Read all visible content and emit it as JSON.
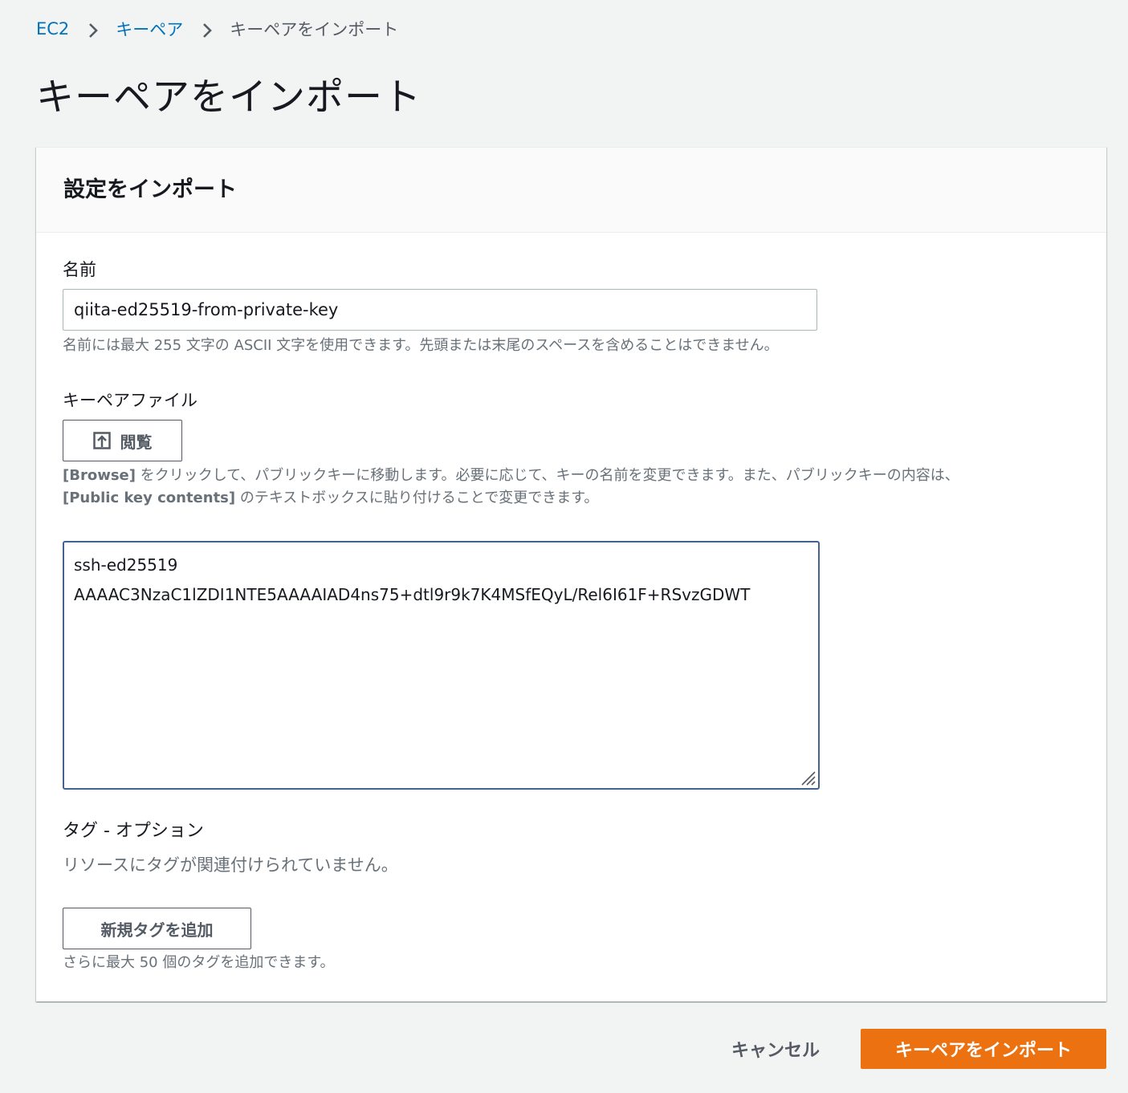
{
  "breadcrumb": {
    "items": [
      {
        "label": "EC2"
      },
      {
        "label": "キーペア"
      },
      {
        "label": "キーペアをインポート"
      }
    ]
  },
  "page": {
    "title": "キーペアをインポート"
  },
  "panel": {
    "title": "設定をインポート",
    "name_field": {
      "label": "名前",
      "value": "qiita-ed25519-from-private-key",
      "hint": "名前には最大 255 文字の ASCII 文字を使用できます。先頭または末尾のスペースを含めることはできません。"
    },
    "key_file": {
      "label": "キーペアファイル",
      "browse_label": "閲覧",
      "hint_line1_bold": "[Browse]",
      "hint_line1_rest": " をクリックして、パブリックキーに移動します。必要に応じて、キーの名前を変更できます。また、パブリックキーの内容は、",
      "hint_line2_bold": "[Public key contents]",
      "hint_line2_rest": " のテキストボックスに貼り付けることで変更できます。",
      "contents": "ssh-ed25519 AAAAC3NzaC1lZDI1NTE5AAAAIAD4ns75+dtl9r9k7K4MSfEQyL/Rel6I61F+RSvzGDWT"
    },
    "tags": {
      "title": "タグ - オプション",
      "empty_text": "リソースにタグが関連付けられていません。",
      "add_label": "新規タグを追加",
      "hint": "さらに最大 50 個のタグを追加できます。"
    }
  },
  "actions": {
    "cancel_label": "キャンセル",
    "submit_label": "キーペアをインポート"
  },
  "colors": {
    "link": "#0073bb",
    "primary": "#ec7211",
    "focus_border": "#44628f",
    "background": "#f2f3f3"
  },
  "icons": {
    "breadcrumb_separator": "chevron-right-icon",
    "browse": "upload-icon",
    "resize": "resize-grip-icon"
  }
}
